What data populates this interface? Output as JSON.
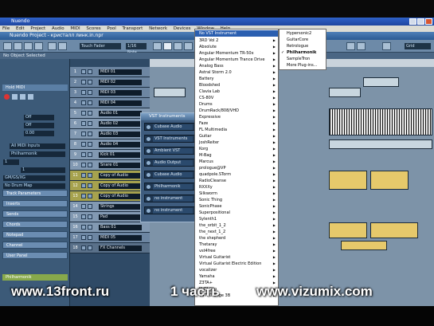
{
  "window": {
    "title": "Nuendo",
    "menu": [
      "File",
      "Edit",
      "Project",
      "Audio",
      "MIDI",
      "Scores",
      "Pool",
      "Transport",
      "Network",
      "Devices",
      "Window",
      "Help"
    ]
  },
  "project": {
    "title": "Nuendo Project - кристалл линк.in.npr"
  },
  "toolbar": {
    "mode_touch": "Touch Fader",
    "display_format": "1/16 Note",
    "snap_right": "Grid",
    "quantize_value": "1/16"
  },
  "info_line": "No Object Selected",
  "inspector": {
    "track_name": "Hold MIDI",
    "vol_label": "Off",
    "pan_label": "Off",
    "delay_label": "0.00",
    "output_label": "All MIDI Inputs",
    "channel_label": "Philharmonik",
    "channel_num": "1",
    "bank_label": "1",
    "patch_label": "GM/GS/XG",
    "program_label": "No Drum Map",
    "sections": [
      "Track Parameters",
      "Inserts",
      "Sends",
      "Chords",
      "Notepad",
      "Channel",
      "User Panel"
    ],
    "bottom_label": "Philharmonik"
  },
  "tracks": [
    {
      "num": "1",
      "name": "MIDI 01"
    },
    {
      "num": "2",
      "name": "MIDI 02"
    },
    {
      "num": "3",
      "name": "MIDI 03"
    },
    {
      "num": "4",
      "name": "MIDI 04"
    },
    {
      "num": "5",
      "name": "Audio 01"
    },
    {
      "num": "6",
      "name": "Audio 02"
    },
    {
      "num": "7",
      "name": "Audio 03"
    },
    {
      "num": "8",
      "name": "Audio 04"
    },
    {
      "num": "9",
      "name": "Kick 01"
    },
    {
      "num": "10",
      "name": "Snare 01"
    },
    {
      "num": "11",
      "name": "Copy of Audio"
    },
    {
      "num": "12",
      "name": "Copy of Audio"
    },
    {
      "num": "13",
      "name": "Copy of Audio"
    },
    {
      "num": "14",
      "name": "Strings"
    },
    {
      "num": "15",
      "name": "Pad"
    },
    {
      "num": "16",
      "name": "Bass 01"
    },
    {
      "num": "17",
      "name": "MIDI 05"
    },
    {
      "num": "18",
      "name": "FX Channels"
    }
  ],
  "vst_window": {
    "title": "VST Instruments",
    "slots": [
      "Cubase Audio",
      "VST Instruments",
      "Ambient VST",
      "Audio Output",
      "Cubase Audio",
      "Philharmonik",
      "no instrument",
      "no instrument"
    ]
  },
  "dropdown": {
    "header": "No VST Instrument",
    "items": [
      "3RD Vol 2",
      "Absolute",
      "Angular Momentum TR-50x",
      "Angular Momentum Trance Drive",
      "Analog Bass",
      "Astral Storm 2.0",
      "Battery",
      "Bloodshed",
      "Clavia Lab",
      "CS-80V",
      "Drums",
      "DrumRack/808/VHD",
      "Expressive",
      "Faze",
      "FL Multimedia",
      "Guitar",
      "JoshReiter",
      "Korg",
      "M-Bag",
      "Marcus",
      "prologue@VP",
      "quadpole.STorm",
      "RadioCleanse",
      "RXXXy",
      "Silkworm",
      "Sonic Thing",
      "SonicPhase",
      "Superpositional",
      "Sylenth1",
      "the_orbit_1_2",
      "the_next_1_2",
      "the shepherd",
      "Thetaray",
      "vst4free",
      "Virtual Guitarist",
      "Virtual Guitarist Electric Edition",
      "vocalizer",
      "Yamaha",
      "Z3TA+",
      "MIDI Clip",
      "VSTi Orange 3B"
    ],
    "highlighted_index": 0
  },
  "submenu": {
    "items": [
      "Hypersonic2",
      "GuitarCore",
      "Retrologue",
      "Philharmonik",
      "SampleTron",
      "More Plug-ins..."
    ],
    "checked_index": 3
  },
  "watermark": {
    "left": "www.13front.ru",
    "middle": "1 часть",
    "right": "www.vizumix.com"
  }
}
